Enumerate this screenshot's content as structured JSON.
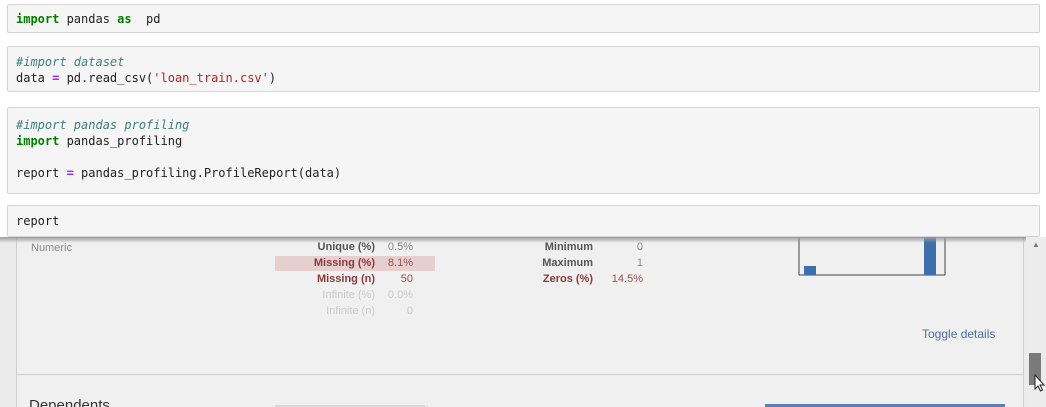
{
  "cells": [
    {
      "lines": [
        [
          {
            "t": "import",
            "c": "kw"
          },
          {
            "t": " pandas ",
            "c": ""
          },
          {
            "t": "as",
            "c": "kw"
          },
          {
            "t": "  pd",
            "c": ""
          }
        ]
      ]
    },
    {
      "lines": [
        [
          {
            "t": "#import dataset",
            "c": "cm"
          }
        ],
        [
          {
            "t": "data ",
            "c": ""
          },
          {
            "t": "=",
            "c": "op"
          },
          {
            "t": " pd.read_csv(",
            "c": ""
          },
          {
            "t": "'loan_train.csv'",
            "c": "str"
          },
          {
            "t": ")",
            "c": ""
          }
        ]
      ]
    },
    {
      "lines": [
        [
          {
            "t": "#import pandas profiling",
            "c": "cm"
          }
        ],
        [
          {
            "t": "import",
            "c": "kw"
          },
          {
            "t": " pandas_profiling",
            "c": ""
          }
        ],
        [
          {
            "t": "",
            "c": ""
          }
        ],
        [
          {
            "t": "report ",
            "c": ""
          },
          {
            "t": "=",
            "c": "op"
          },
          {
            "t": " pandas_profiling.ProfileReport(data)",
            "c": ""
          }
        ]
      ]
    },
    {
      "lines": [
        [
          {
            "t": "report",
            "c": ""
          }
        ]
      ]
    }
  ],
  "output": {
    "variable_type": "Numeric",
    "left_stats": [
      {
        "label": "Unique (%)",
        "value": "0.5%",
        "style": "normal"
      },
      {
        "label": "Missing (%)",
        "value": "8.1%",
        "style": "warn-bg"
      },
      {
        "label": "Missing (n)",
        "value": "50",
        "style": "warn"
      },
      {
        "label": "Infinite (%)",
        "value": "0.0%",
        "style": "faded"
      },
      {
        "label": "Infinite (n)",
        "value": "0",
        "style": "faded"
      }
    ],
    "right_stats": [
      {
        "label": "Minimum",
        "value": "0",
        "style": "normal"
      },
      {
        "label": "Maximum",
        "value": "1",
        "style": "normal"
      },
      {
        "label": "Zeros (%)",
        "value": "14.5%",
        "style": "warn"
      }
    ],
    "toggle_details": "Toggle details",
    "next_section_heading": "Dependents"
  },
  "colors": {
    "bar": "#3d6fae",
    "link": "#4a6f9a",
    "warn_bg": "#e6cfcf"
  }
}
